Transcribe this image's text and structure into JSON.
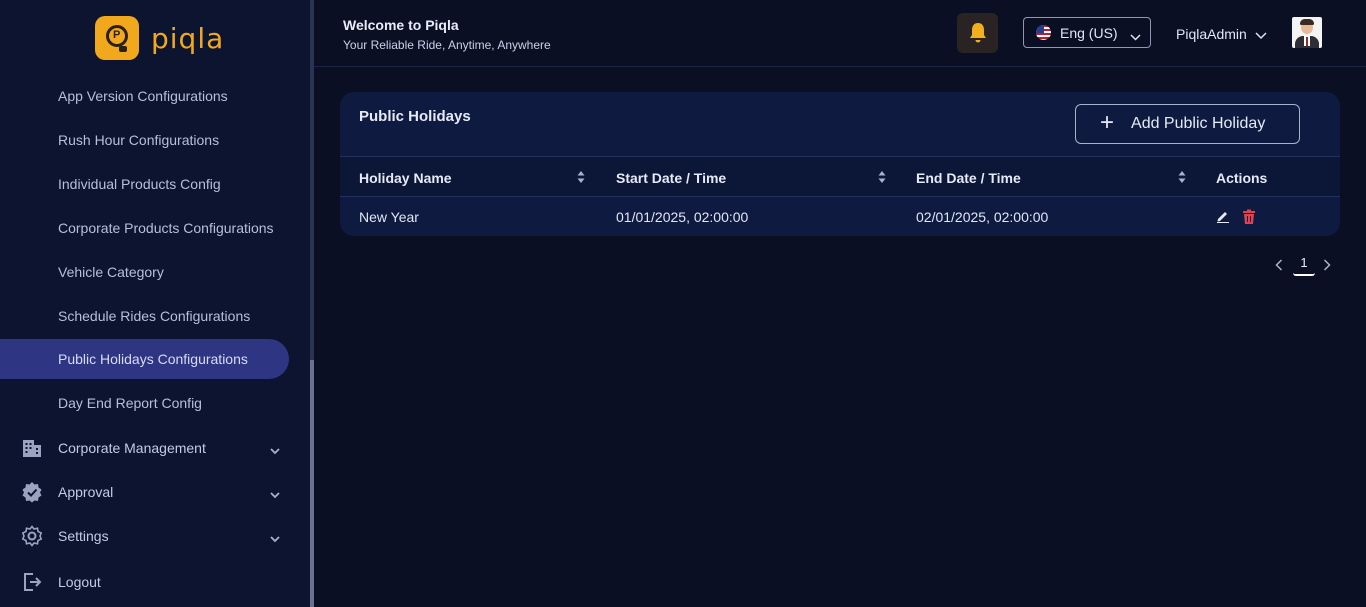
{
  "app": {
    "logo_text": "piqla"
  },
  "sidebar": {
    "items": [
      {
        "label": "App Version Configurations"
      },
      {
        "label": "Rush Hour Configurations"
      },
      {
        "label": "Individual Products Config"
      },
      {
        "label": "Corporate Products Configurations"
      },
      {
        "label": "Vehicle Category"
      },
      {
        "label": "Schedule Rides Configurations"
      },
      {
        "label": "Public Holidays Configurations"
      },
      {
        "label": "Day End Report Config"
      }
    ],
    "active_item": "Public Holidays Configurations",
    "groups": [
      {
        "label": "Corporate Management",
        "icon": "building-icon"
      },
      {
        "label": "Approval",
        "icon": "verified-badge-icon"
      },
      {
        "label": "Settings",
        "icon": "gear-icon"
      }
    ],
    "logout_label": "Logout"
  },
  "header": {
    "welcome_title": "Welcome to Piqla",
    "tagline": "Your Reliable Ride, Anytime, Anywhere",
    "language_selected": "Eng (US)",
    "user_name": "PiqlaAdmin"
  },
  "main": {
    "card_title": "Public Holidays",
    "add_button_label": "Add Public Holiday",
    "table": {
      "columns": [
        "Holiday Name",
        "Start Date / Time",
        "End Date / Time",
        "Actions"
      ],
      "rows": [
        {
          "holiday_name": "New Year",
          "start": "01/01/2025, 02:00:00",
          "end": "02/01/2025, 02:00:00"
        }
      ]
    },
    "pagination": {
      "current_page": "1"
    }
  },
  "colors": {
    "background": "#0a0f24",
    "sidebar": "#0c1430",
    "active_item": "#2e3583",
    "brand": "#f2a81d",
    "bell": "#f2b01e",
    "delete": "#e0424f"
  }
}
